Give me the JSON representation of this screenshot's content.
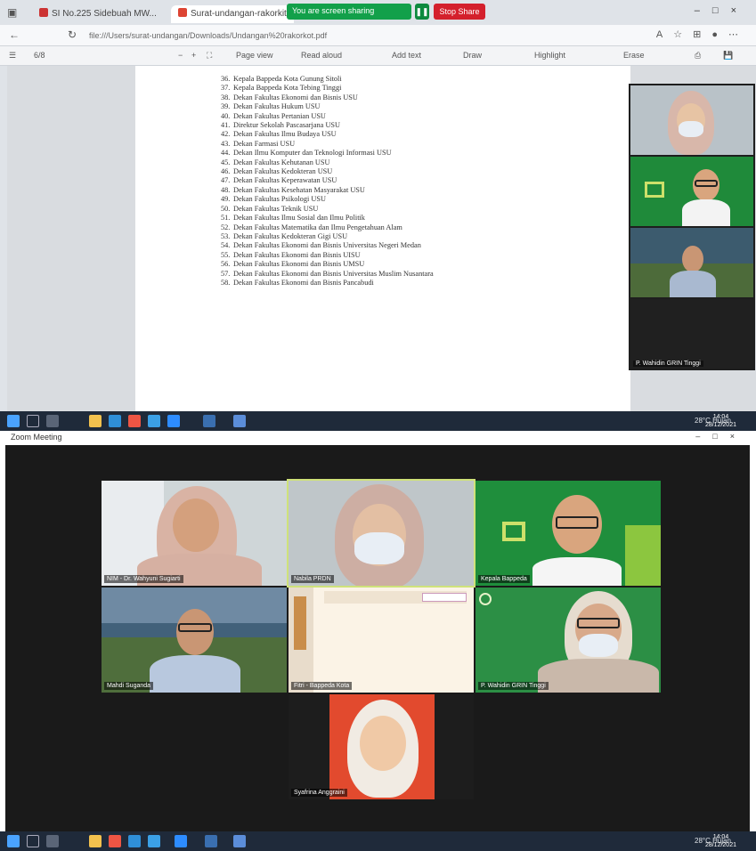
{
  "browser": {
    "tabs": [
      {
        "label": "SI No.225 Sidebuah MW..."
      },
      {
        "label": "Surat-undangan-rakorkit.pdf"
      }
    ],
    "share": {
      "status": "You are screen sharing",
      "stop_label": "Stop Share"
    },
    "url": "file:///Users/surat-undangan/Downloads/Undangan%20rakorkot.pdf",
    "toolbar": {
      "page": "6/8",
      "zoom": "+",
      "page_view": "Page view",
      "read_aloud": "Read aloud",
      "add_text": "Add text",
      "draw": "Draw",
      "highlight": "Highlight",
      "erase": "Erase"
    },
    "document_lines": [
      {
        "num": "36.",
        "text": "Kepala Bappeda Kota Gunung Sitoli"
      },
      {
        "num": "37.",
        "text": "Kepala Bappeda Kota Tebing Tinggi"
      },
      {
        "num": "38.",
        "text": "Dekan Fakultas Ekonomi dan Bisnis USU"
      },
      {
        "num": "39.",
        "text": "Dekan Fakultas Hukum USU"
      },
      {
        "num": "40.",
        "text": "Dekan Fakultas Pertanian USU"
      },
      {
        "num": "41.",
        "text": "Direktur Sekolah Pascasarjana USU"
      },
      {
        "num": "42.",
        "text": "Dekan Fakultas Ilmu Budaya USU"
      },
      {
        "num": "43.",
        "text": "Dekan Farmasi USU"
      },
      {
        "num": "44.",
        "text": "Dekan Ilmu Komputer dan Teknologi Informasi USU"
      },
      {
        "num": "45.",
        "text": "Dekan Fakultas Kehutanan USU"
      },
      {
        "num": "46.",
        "text": "Dekan Fakultas Kedokteran USU"
      },
      {
        "num": "47.",
        "text": "Dekan Fakultas Keperawatan USU"
      },
      {
        "num": "48.",
        "text": "Dekan Fakultas Kesehatan Masyarakat USU"
      },
      {
        "num": "49.",
        "text": "Dekan Fakultas Psikologi USU"
      },
      {
        "num": "50.",
        "text": "Dekan Fakultas Teknik USU"
      },
      {
        "num": "51.",
        "text": "Dekan Fakultas Ilmu Sosial dan Ilmu Politik"
      },
      {
        "num": "52.",
        "text": "Dekan Fakultas Matematika dan Ilmu Pengetahuan Alam"
      },
      {
        "num": "53.",
        "text": "Dekan Fakultas Kedokteran Gigi USU"
      },
      {
        "num": "54.",
        "text": "Dekan Fakultas Ekonomi dan Bisnis Universitas Negeri Medan"
      },
      {
        "num": "55.",
        "text": "Dekan Fakultas Ekonomi dan Bisnis UISU"
      },
      {
        "num": "56.",
        "text": "Dekan Fakultas Ekonomi dan Bisnis UMSU"
      },
      {
        "num": "57.",
        "text": "Dekan Fakultas Ekonomi dan Bisnis Universitas Muslim Nusantara"
      },
      {
        "num": "58.",
        "text": "Dekan Fakultas Ekonomi dan Bisnis Pancabudi"
      }
    ],
    "side_participants": [
      {
        "name": ""
      },
      {
        "name": ""
      },
      {
        "name": ""
      },
      {
        "name": "P. Wahidin GRIN Tinggi"
      }
    ]
  },
  "taskbar": {
    "weather": "28°C Hujan",
    "time": "14:04",
    "date": "28/12/2021"
  },
  "zoom": {
    "window_title": "Zoom Meeting",
    "participants": [
      {
        "name": "NIM - Dr. Wahyuni Sugiarti"
      },
      {
        "name": "Nabila PRDN"
      },
      {
        "name": "Kepala Bappeda"
      },
      {
        "name": "Mahdi Suganda"
      },
      {
        "name": "Fitri - Bappeda Kota"
      },
      {
        "name": "P. Wahidin GRIN Tinggi"
      },
      {
        "name": "Syafrina Anggraini"
      }
    ]
  }
}
